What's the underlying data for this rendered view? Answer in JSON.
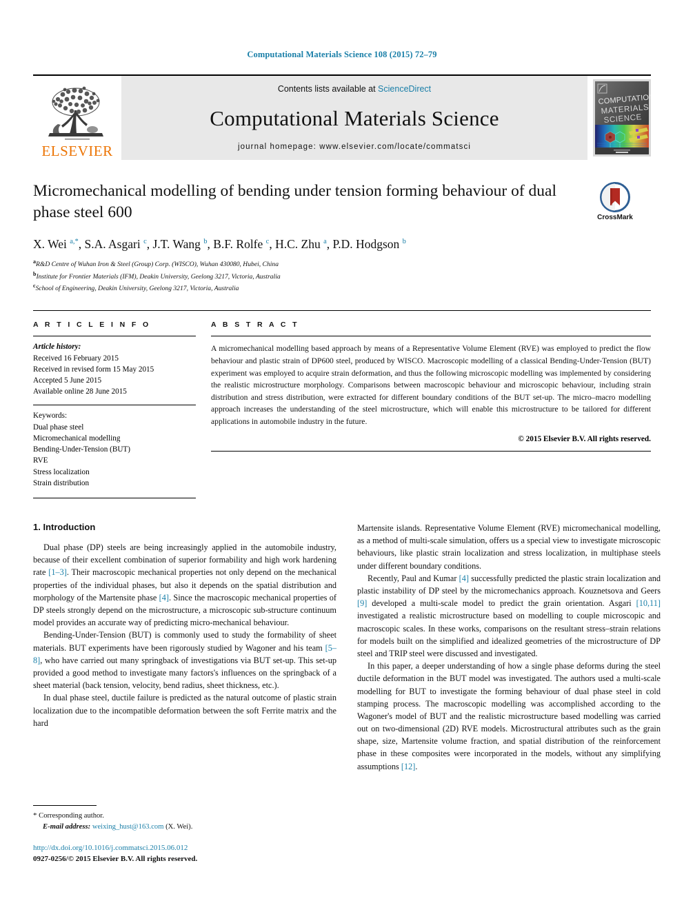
{
  "running_head": "Computational Materials Science 108 (2015) 72–79",
  "masthead": {
    "publisher_name": "ELSEVIER",
    "contents_prefix": "Contents lists available at ",
    "contents_link": "ScienceDirect",
    "journal_name": "Computational Materials Science",
    "homepage": "journal homepage: www.elsevier.com/locate/commatsci",
    "cover_title_line1": "COMPUTATIONAL",
    "cover_title_line2": "MATERIALS",
    "cover_title_line3": "SCIENCE"
  },
  "article": {
    "title": "Micromechanical modelling of bending under tension forming behaviour of dual phase steel 600",
    "crossmark_label": "CrossMark",
    "authors_html": "X. Wei <sup>a,*</sup>, S.A. Asgari <sup>c</sup>, J.T. Wang <sup>b</sup>, B.F. Rolfe <sup>c</sup>, H.C. Zhu <sup>a</sup>, P.D. Hodgson <sup>b</sup>",
    "affiliations": [
      {
        "marker": "a",
        "text": "R&D Centre of Wuhan Iron & Steel (Group) Corp. (WISCO), Wuhan 430080, Hubei, China"
      },
      {
        "marker": "b",
        "text": "Institute for Frontier Materials (IFM), Deakin University, Geelong 3217, Victoria, Australia"
      },
      {
        "marker": "c",
        "text": "School of Engineering, Deakin University, Geelong 3217, Victoria, Australia"
      }
    ]
  },
  "article_info": {
    "heading": "A R T I C L E   I N F O",
    "history_label": "Article history:",
    "history": [
      "Received 16 February 2015",
      "Received in revised form 15 May 2015",
      "Accepted 5 June 2015",
      "Available online 28 June 2015"
    ],
    "keywords_label": "Keywords:",
    "keywords": [
      "Dual phase steel",
      "Micromechanical modelling",
      "Bending-Under-Tension (BUT)",
      "RVE",
      "Stress localization",
      "Strain distribution"
    ]
  },
  "abstract": {
    "heading": "A B S T R A C T",
    "text": "A micromechanical modelling based approach by means of a Representative Volume Element (RVE) was employed to predict the flow behaviour and plastic strain of DP600 steel, produced by WISCO. Macroscopic modelling of a classical Bending-Under-Tension (BUT) experiment was employed to acquire strain deformation, and thus the following microscopic modelling was implemented by considering the realistic microstructure morphology. Comparisons between macroscopic behaviour and microscopic behaviour, including strain distribution and stress distribution, were extracted for different boundary conditions of the BUT set-up. The micro–macro modelling approach increases the understanding of the steel microstructure, which will enable this microstructure to be tailored for different applications in automobile industry in the future.",
    "copyright": "© 2015 Elsevier B.V. All rights reserved."
  },
  "body": {
    "section_title": "1. Introduction",
    "left_paragraphs_html": [
      "Dual phase (DP) steels are being increasingly applied in the automobile industry, because of their excellent combination of superior formability and high work hardening rate <span class=\"cite\">[1–3]</span>. Their macroscopic mechanical properties not only depend on the mechanical properties of the individual phases, but also it depends on the spatial distribution and morphology of the Martensite phase <span class=\"cite\">[4]</span>. Since the macroscopic mechanical properties of DP steels strongly depend on the microstructure, a microscopic sub-structure continuum model provides an accurate way of predicting micro-mechanical behaviour.",
      "Bending-Under-Tension (BUT) is commonly used to study the formability of sheet materials. BUT experiments have been rigorously studied by Wagoner and his team <span class=\"cite\">[5–8]</span>, who have carried out many springback of investigations via BUT set-up. This set-up provided a good method to investigate many factors's influences on the springback of a sheet material (back tension, velocity, bend radius, sheet thickness, etc.).",
      "In dual phase steel, ductile failure is predicted as the natural outcome of plastic strain localization due to the incompatible deformation between the soft Ferrite matrix and the hard"
    ],
    "right_paragraphs_html": [
      "Martensite islands. Representative Volume Element (RVE) micromechanical modelling, as a method of multi-scale simulation, offers us a special view to investigate microscopic behaviours, like plastic strain localization and stress localization, in multiphase steels under different boundary conditions.",
      "Recently, Paul and Kumar <span class=\"cite\">[4]</span> successfully predicted the plastic strain localization and plastic instability of DP steel by the micromechanics approach. Kouznetsova and Geers <span class=\"cite\">[9]</span> developed a multi-scale model to predict the grain orientation. Asgari <span class=\"cite\">[10,11]</span> investigated a realistic microstructure based on modelling to couple microscopic and macroscopic scales. In these works, comparisons on the resultant stress–strain relations for models built on the simplified and idealized geometries of the microstructure of DP steel and TRIP steel were discussed and investigated.",
      "In this paper, a deeper understanding of how a single phase deforms during the steel ductile deformation in the BUT model was investigated. The authors used a multi-scale modelling for BUT to investigate the forming behaviour of dual phase steel in cold stamping process. The macroscopic modelling was accomplished according to the Wagoner's model of BUT and the realistic microstructure based modelling was carried out on two-dimensional (2D) RVE models. Microstructural attributes such as the grain shape, size, Martensite volume fraction, and spatial distribution of the reinforcement phase in these composites were incorporated in the models, without any simplifying assumptions <span class=\"cite\">[12]</span>."
    ]
  },
  "footnotes": {
    "corresponding_marker": "*",
    "corresponding_text": "Corresponding author.",
    "email_label": "E-mail address:",
    "email": "weixing_hust@163.com",
    "email_owner": "(X. Wei).",
    "doi": "http://dx.doi.org/10.1016/j.commatsci.2015.06.012",
    "issn_line": "0927-0256/© 2015 Elsevier B.V. All rights reserved."
  },
  "colors": {
    "link_blue": "#1a7fa8",
    "elsevier_orange": "#ec7404",
    "banner_gray": "#e8e8e8"
  }
}
